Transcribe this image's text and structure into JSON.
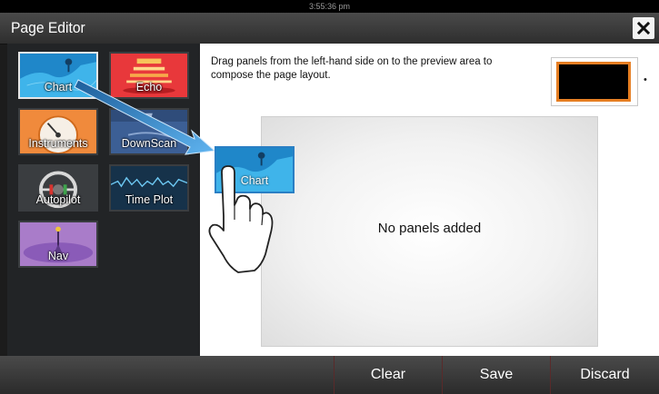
{
  "status_bar": {
    "time": "3:55:36 pm"
  },
  "header": {
    "title": "Page Editor",
    "close_icon": "close-icon"
  },
  "palette": {
    "panels": [
      {
        "label": "Chart",
        "icon": "chart-panel-icon",
        "selected": true
      },
      {
        "label": "Echo",
        "icon": "echo-panel-icon",
        "selected": false
      },
      {
        "label": "Instruments",
        "icon": "instruments-panel-icon",
        "selected": false
      },
      {
        "label": "DownScan",
        "icon": "downscan-panel-icon",
        "selected": false
      },
      {
        "label": "Autopilot",
        "icon": "autopilot-panel-icon",
        "selected": false
      },
      {
        "label": "Time Plot",
        "icon": "time-plot-panel-icon",
        "selected": false
      },
      {
        "label": "Nav",
        "icon": "nav-panel-icon",
        "selected": false
      }
    ]
  },
  "main": {
    "instruction": "Drag panels from the left-hand side on to the preview area to compose the page layout.",
    "layout_selector": {
      "accent_color": "#e67e22"
    },
    "preview": {
      "empty_message": "No panels added"
    }
  },
  "drag_overlay": {
    "label": "Chart",
    "icons": [
      "drag-arrow-icon",
      "hand-pointer-icon"
    ]
  },
  "footer": {
    "buttons": [
      "Clear",
      "Save",
      "Discard"
    ]
  },
  "colors": {
    "accent": "#2a7fc4",
    "chart_blue": "#36a9e1",
    "echo_red": "#e8383b",
    "instruments_orange": "#f08a3c",
    "nav_purple": "#8a5bb8"
  }
}
